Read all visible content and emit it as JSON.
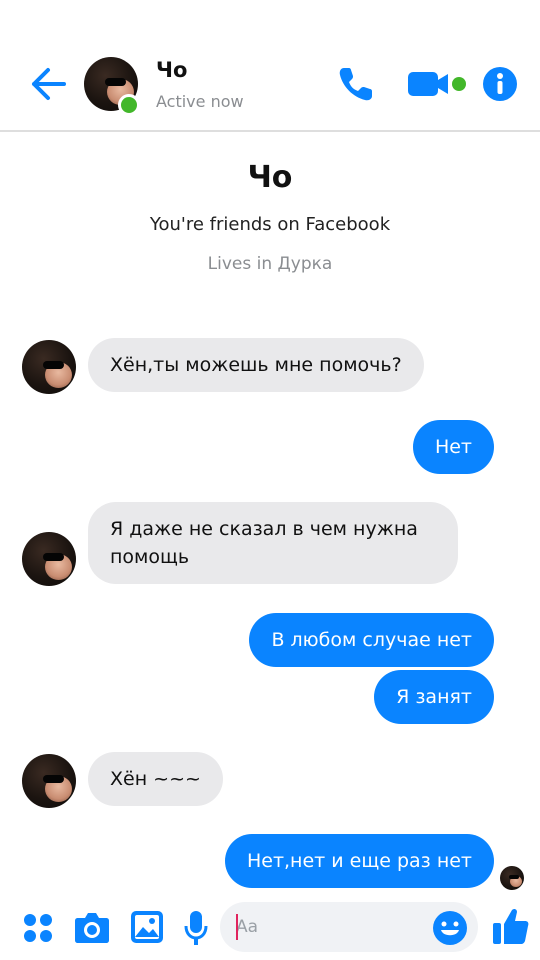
{
  "header": {
    "contact_name": "Чо",
    "status": "Active now",
    "icons": [
      "back-arrow-icon",
      "phone-icon",
      "video-camera-icon",
      "info-icon"
    ]
  },
  "intro": {
    "name": "Чо",
    "friends_text": "You're friends on Facebook",
    "lives_text": "Lives in Дурка"
  },
  "messages": [
    {
      "from": "contact",
      "text": "Хён,ты можешь мне помочь?"
    },
    {
      "from": "me",
      "text": "Нет"
    },
    {
      "from": "contact",
      "text": "Я даже не сказал в чем нужна помощь"
    },
    {
      "from": "me",
      "text": "В любом случае нет"
    },
    {
      "from": "me",
      "text": "Я занят"
    },
    {
      "from": "contact",
      "text": "Хён ~~~"
    },
    {
      "from": "me",
      "text": "Нет,нет и еще раз нет"
    }
  ],
  "composer": {
    "placeholder": "Aa",
    "icons": [
      "menu-grid-icon",
      "camera-icon",
      "gallery-icon",
      "microphone-icon",
      "emoji-icon",
      "thumbs-up-icon"
    ]
  },
  "colors": {
    "accent": "#0a84ff",
    "online": "#42b72a",
    "incoming_bubble": "#e9e9eb"
  }
}
